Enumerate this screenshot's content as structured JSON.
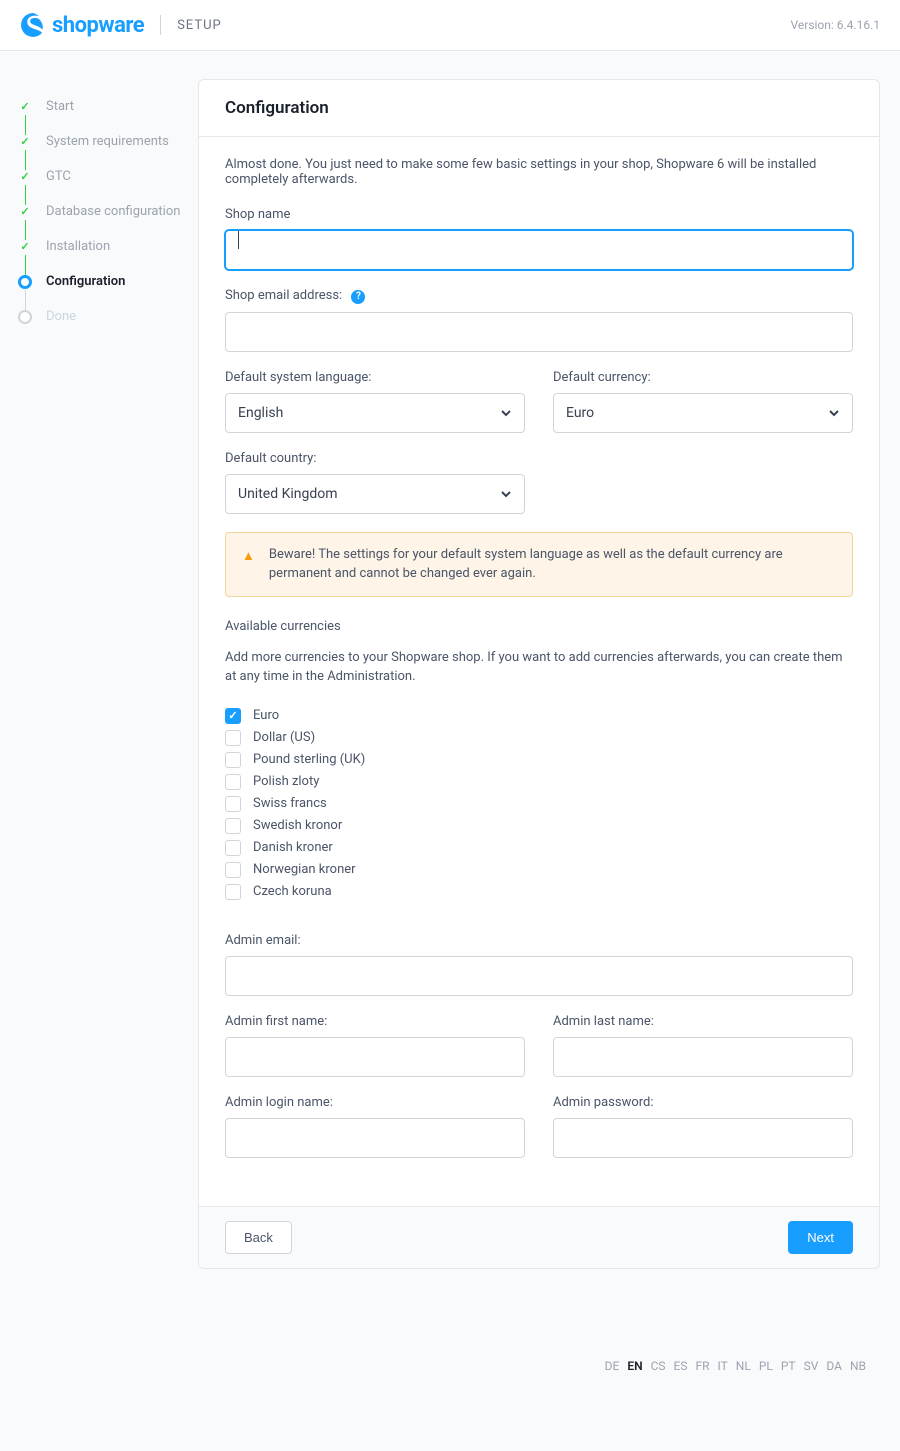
{
  "header": {
    "brand": "shopware",
    "setup": "SETUP",
    "version": "Version: 6.4.16.1"
  },
  "steps": [
    {
      "label": "Start",
      "state": "done"
    },
    {
      "label": "System requirements",
      "state": "done"
    },
    {
      "label": "GTC",
      "state": "done"
    },
    {
      "label": "Database configuration",
      "state": "done"
    },
    {
      "label": "Installation",
      "state": "done"
    },
    {
      "label": "Configuration",
      "state": "current"
    },
    {
      "label": "Done",
      "state": "pending"
    }
  ],
  "card": {
    "title": "Configuration",
    "intro": "Almost done. You just need to make some few basic settings in your shop, Shopware 6 will be installed completely afterwards.",
    "shop_name_label": "Shop name",
    "shop_email_label": "Shop email address:",
    "system_language_label": "Default system language:",
    "system_language_value": "English",
    "currency_label": "Default currency:",
    "currency_value": "Euro",
    "country_label": "Default country:",
    "country_value": "United Kingdom",
    "alert": "Beware! The settings for your default system language as well as the default currency are permanent and cannot be changed ever again.",
    "available_currencies_title": "Available currencies",
    "available_currencies_desc": "Add more currencies to your Shopware shop. If you want to add currencies afterwards, you can create them at any time in the Administration.",
    "currencies": [
      {
        "label": "Euro",
        "checked": true
      },
      {
        "label": "Dollar (US)",
        "checked": false
      },
      {
        "label": "Pound sterling (UK)",
        "checked": false
      },
      {
        "label": "Polish zloty",
        "checked": false
      },
      {
        "label": "Swiss francs",
        "checked": false
      },
      {
        "label": "Swedish kronor",
        "checked": false
      },
      {
        "label": "Danish kroner",
        "checked": false
      },
      {
        "label": "Norwegian kroner",
        "checked": false
      },
      {
        "label": "Czech koruna",
        "checked": false
      }
    ],
    "admin_email_label": "Admin email:",
    "admin_first_name_label": "Admin first name:",
    "admin_last_name_label": "Admin last name:",
    "admin_login_label": "Admin login name:",
    "admin_password_label": "Admin password:",
    "back": "Back",
    "next": "Next"
  },
  "languages": [
    "DE",
    "EN",
    "CS",
    "ES",
    "FR",
    "IT",
    "NL",
    "PL",
    "PT",
    "SV",
    "DA",
    "NB"
  ],
  "active_language": "EN"
}
